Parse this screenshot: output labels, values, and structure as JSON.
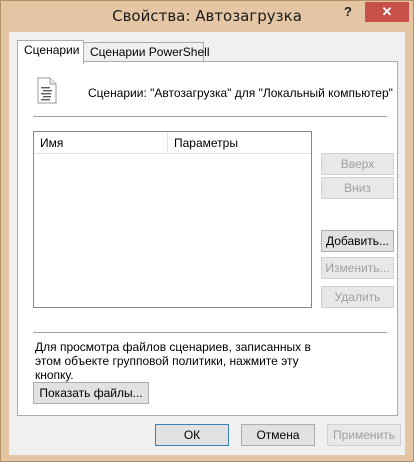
{
  "window": {
    "title": "Свойства: Автозагрузка",
    "help_label": "?",
    "close_label": "✕",
    "frame_color": "#e5c6a4",
    "close_color": "#c7504a"
  },
  "tabs": [
    {
      "label": "Сценарии",
      "active": true
    },
    {
      "label": "Сценарии PowerShell",
      "active": false
    }
  ],
  "header": {
    "icon": "script-document-icon",
    "text": "Сценарии: \"Автозагрузка\" для \"Локальный компьютер\""
  },
  "list": {
    "columns": [
      "Имя",
      "Параметры"
    ],
    "rows": []
  },
  "side_buttons": {
    "up": "Вверх",
    "down": "Вниз",
    "add": "Добавить...",
    "edit": "Изменить...",
    "remove": "Удалить"
  },
  "note": "Для просмотра файлов сценариев, записанных в этом объекте групповой политики, нажмите эту кнопку.",
  "show_files_button": "Показать файлы...",
  "footer": {
    "ok": "ОК",
    "cancel": "Отмена",
    "apply": "Применить"
  }
}
